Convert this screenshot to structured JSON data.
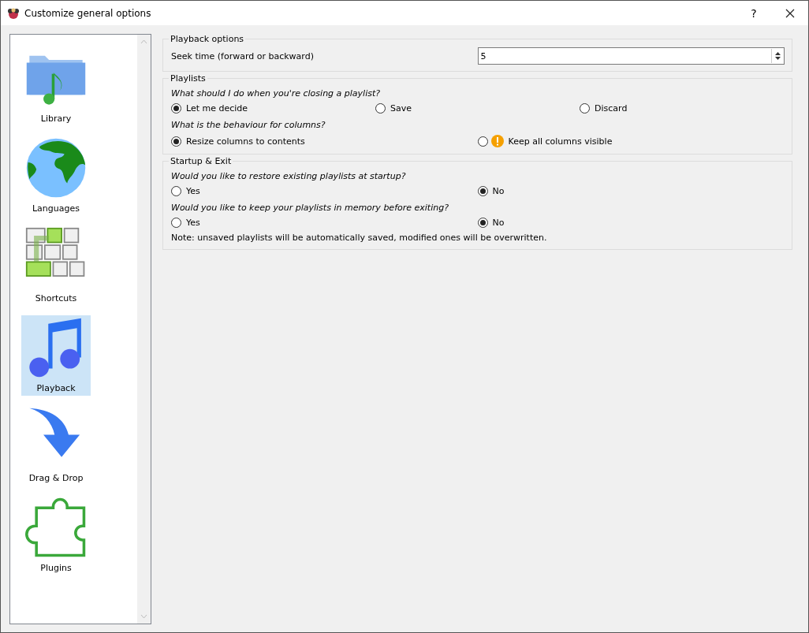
{
  "window": {
    "title": "Customize general options",
    "help": "?"
  },
  "sidebar": {
    "items": [
      {
        "label": "Library",
        "kind": "library",
        "selected": false
      },
      {
        "label": "Languages",
        "kind": "languages",
        "selected": false
      },
      {
        "label": "Shortcuts",
        "kind": "shortcuts",
        "selected": false
      },
      {
        "label": "Playback",
        "kind": "playback",
        "selected": true
      },
      {
        "label": "Drag & Drop",
        "kind": "dragdrop",
        "selected": false
      },
      {
        "label": "Plugins",
        "kind": "plugins",
        "selected": false
      }
    ]
  },
  "sections": [
    {
      "title": "Playback options",
      "rows": [
        {
          "kind": "spin",
          "label": "Seek time (forward or backward)",
          "value": "5"
        }
      ]
    },
    {
      "title": "Playlists",
      "rows": [
        {
          "kind": "question",
          "text": "What should I do when you're closing a playlist?"
        },
        {
          "kind": "radios",
          "options": [
            {
              "label": "Let me decide",
              "selected": true,
              "warning": false
            },
            {
              "label": "Save",
              "selected": false,
              "warning": false
            },
            {
              "label": "Discard",
              "selected": false,
              "warning": false
            }
          ]
        },
        {
          "kind": "question",
          "text": "What is the behaviour for columns?"
        },
        {
          "kind": "radios",
          "options": [
            {
              "label": "Resize columns to contents",
              "selected": true,
              "warning": false
            },
            {
              "label": "Keep all columns visible",
              "selected": false,
              "warning": true
            }
          ]
        }
      ]
    },
    {
      "title": "Startup & Exit",
      "rows": [
        {
          "kind": "question",
          "text": "Would you like to restore existing playlists at startup?"
        },
        {
          "kind": "radios",
          "options": [
            {
              "label": "Yes",
              "selected": false,
              "warning": false
            },
            {
              "label": "No",
              "selected": true,
              "warning": false
            }
          ]
        },
        {
          "kind": "question",
          "text": "Would you like to keep your playlists in memory before exiting?"
        },
        {
          "kind": "radios",
          "options": [
            {
              "label": "Yes",
              "selected": false,
              "warning": false
            },
            {
              "label": "No",
              "selected": true,
              "warning": false
            }
          ]
        },
        {
          "kind": "note",
          "text": "Note: unsaved playlists will be automatically saved, modified ones will be overwritten."
        }
      ]
    }
  ]
}
